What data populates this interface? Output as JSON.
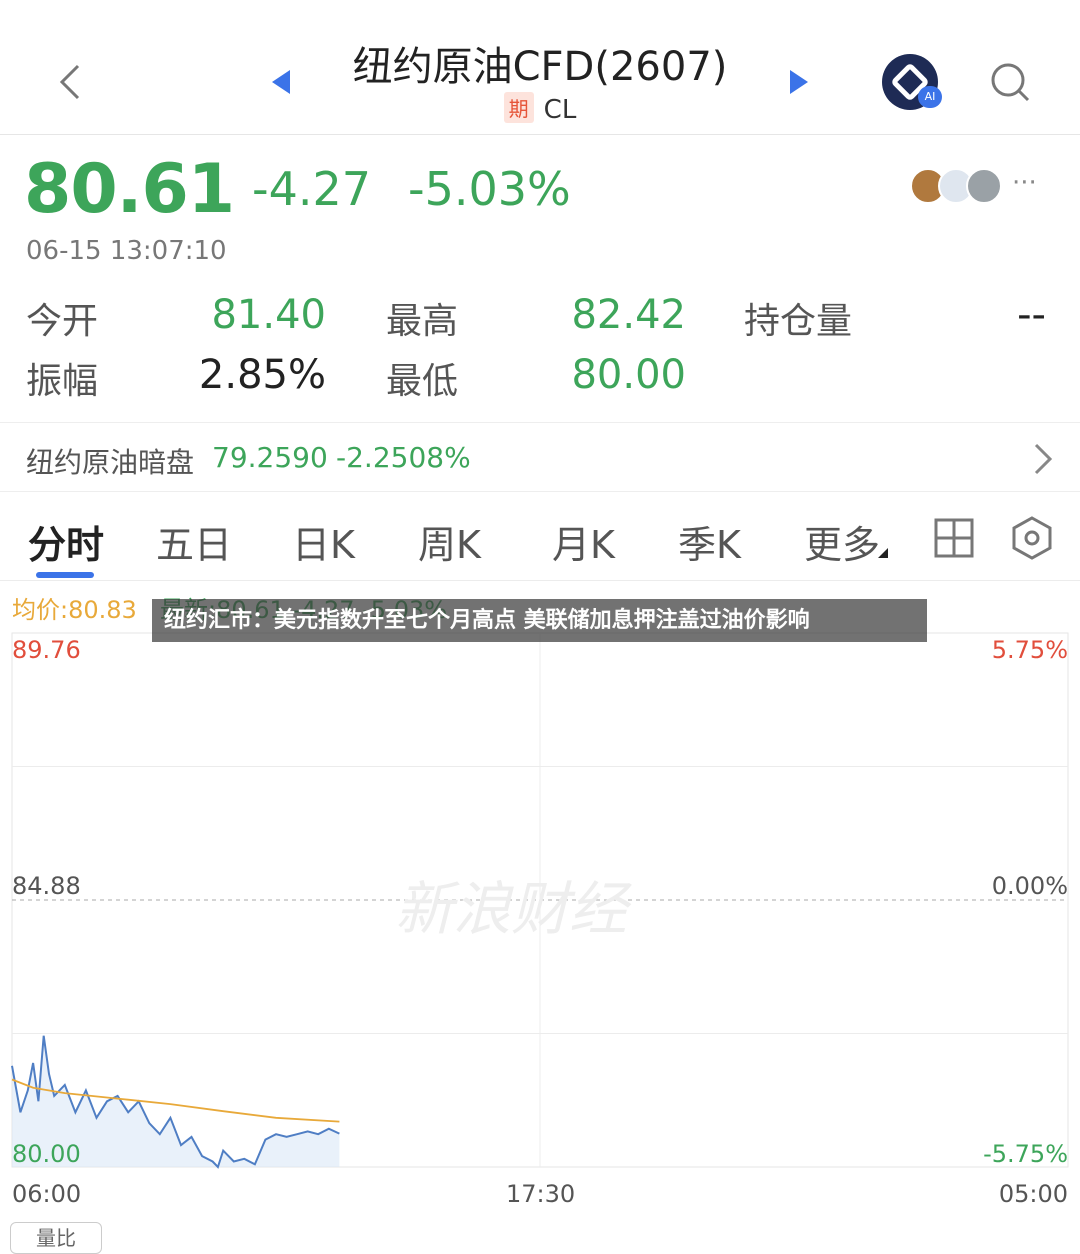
{
  "header": {
    "title": "纽约原油CFD(2607)",
    "tag": "期",
    "code": "CL",
    "ai_label": "AI"
  },
  "quote": {
    "price": "80.61",
    "change": "-4.27",
    "change_pct": "-5.03%",
    "timestamp": "06-15 13:07:10",
    "more": "···",
    "stats": {
      "open_label": "今开",
      "open": "81.40",
      "high_label": "最高",
      "high": "82.42",
      "oi_label": "持仓量",
      "oi": "--",
      "amp_label": "振幅",
      "amp": "2.85%",
      "low_label": "最低",
      "low": "80.00"
    }
  },
  "dark_pool": {
    "label": "纽约原油暗盘",
    "value": "79.2590",
    "change_pct": "-2.2508%"
  },
  "tabs": [
    "分时",
    "五日",
    "日K",
    "周K",
    "月K",
    "季K",
    "更多"
  ],
  "chart_meta": {
    "avg": "均价:80.83",
    "latest": "最新:80.61 -4.27 -5.03%"
  },
  "news_banner": "纽约汇市：美元指数升至七个月高点 美联储加息押注盖过油价影响",
  "watermark": "新浪财经",
  "volume_button": "量比",
  "colors": {
    "up": "#e14e3c",
    "down": "#3da55a",
    "accent": "#3b73e8",
    "avg_line": "#e8a93a"
  },
  "chart_data": {
    "type": "line",
    "title": "",
    "x_ticks": [
      "06:00",
      "17:30",
      "05:00"
    ],
    "y_left_ticks": [
      "89.76",
      "84.88",
      "80.00"
    ],
    "y_right_ticks": [
      "5.75%",
      "0.00%",
      "-5.75%"
    ],
    "ylim": [
      80.0,
      89.76
    ],
    "reference_price": 84.88,
    "series": [
      {
        "name": "最新",
        "x_fraction": [
          0.0,
          0.008,
          0.015,
          0.02,
          0.025,
          0.03,
          0.035,
          0.04,
          0.05,
          0.06,
          0.07,
          0.08,
          0.09,
          0.1,
          0.11,
          0.12,
          0.13,
          0.14,
          0.15,
          0.16,
          0.17,
          0.18,
          0.19,
          0.195,
          0.2,
          0.21,
          0.22,
          0.23,
          0.24,
          0.25,
          0.26,
          0.27,
          0.28,
          0.29,
          0.3,
          0.31
        ],
        "values": [
          81.85,
          81.0,
          81.4,
          81.9,
          81.2,
          82.4,
          81.7,
          81.3,
          81.5,
          81.0,
          81.4,
          80.9,
          81.2,
          81.3,
          81.0,
          81.2,
          80.8,
          80.6,
          80.9,
          80.4,
          80.55,
          80.2,
          80.1,
          80.0,
          80.3,
          80.1,
          80.15,
          80.05,
          80.5,
          80.6,
          80.55,
          80.6,
          80.65,
          80.6,
          80.7,
          80.61
        ]
      },
      {
        "name": "均价",
        "x_fraction": [
          0.0,
          0.02,
          0.05,
          0.1,
          0.15,
          0.2,
          0.25,
          0.31
        ],
        "values": [
          81.6,
          81.45,
          81.35,
          81.25,
          81.15,
          81.02,
          80.9,
          80.83
        ]
      }
    ]
  }
}
